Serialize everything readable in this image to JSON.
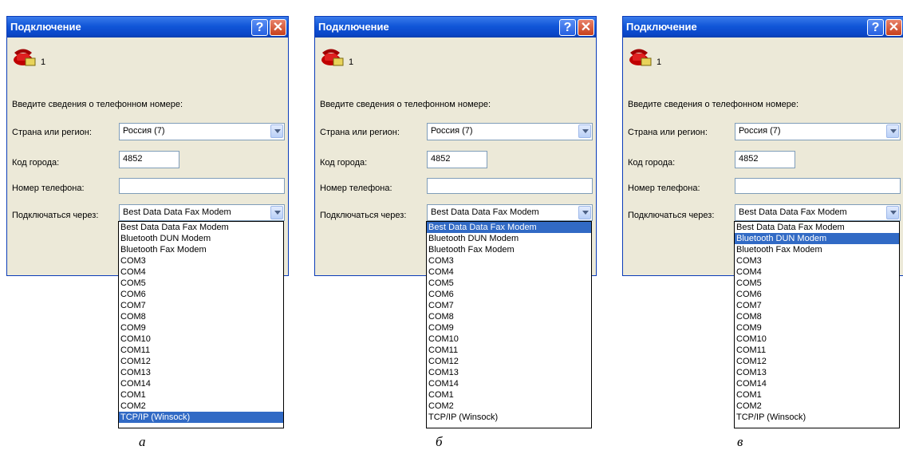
{
  "panels": [
    {
      "title": "Подключение",
      "entry_name": "1",
      "prompt": "Введите сведения о телефонном номере:",
      "labels": {
        "country": "Страна или регион:",
        "city": "Код города:",
        "phone": "Номер телефона:",
        "via": "Подключаться через:"
      },
      "country_value": "Россия (7)",
      "city_value": "4852",
      "phone_value": "",
      "via_value": "Best Data Data Fax Modem",
      "options": [
        "Best Data Data Fax Modem",
        "Bluetooth DUN Modem",
        "Bluetooth Fax Modem",
        "COM3",
        "COM4",
        "COM5",
        "COM6",
        "COM7",
        "COM8",
        "COM9",
        "COM10",
        "COM11",
        "COM12",
        "COM13",
        "COM14",
        "COM1",
        "COM2",
        "TCP/IP (Winsock)"
      ],
      "highlighted_option": "TCP/IP (Winsock)",
      "caption": "а"
    },
    {
      "title": "Подключение",
      "entry_name": "1",
      "prompt": "Введите сведения о телефонном номере:",
      "labels": {
        "country": "Страна или регион:",
        "city": "Код города:",
        "phone": "Номер телефона:",
        "via": "Подключаться через:"
      },
      "country_value": "Россия (7)",
      "city_value": "4852",
      "phone_value": "",
      "via_value": "Best Data Data Fax Modem",
      "options": [
        "Best Data Data Fax Modem",
        "Bluetooth DUN Modem",
        "Bluetooth Fax Modem",
        "COM3",
        "COM4",
        "COM5",
        "COM6",
        "COM7",
        "COM8",
        "COM9",
        "COM10",
        "COM11",
        "COM12",
        "COM13",
        "COM14",
        "COM1",
        "COM2",
        "TCP/IP (Winsock)"
      ],
      "highlighted_option": "Best Data Data Fax Modem",
      "caption": "б"
    },
    {
      "title": "Подключение",
      "entry_name": "1",
      "prompt": "Введите сведения о телефонном номере:",
      "labels": {
        "country": "Страна или регион:",
        "city": "Код города:",
        "phone": "Номер телефона:",
        "via": "Подключаться через:"
      },
      "country_value": "Россия (7)",
      "city_value": "4852",
      "phone_value": "",
      "via_value": "Best Data Data Fax Modem",
      "options": [
        "Best Data Data Fax Modem",
        "Bluetooth DUN Modem",
        "Bluetooth Fax Modem",
        "COM3",
        "COM4",
        "COM5",
        "COM6",
        "COM7",
        "COM8",
        "COM9",
        "COM10",
        "COM11",
        "COM12",
        "COM13",
        "COM14",
        "COM1",
        "COM2",
        "TCP/IP (Winsock)"
      ],
      "highlighted_option": "Bluetooth DUN Modem",
      "caption": "в"
    }
  ],
  "icons": {
    "help": "help-icon",
    "close": "close-icon",
    "phone": "phone-icon",
    "dropdown": "chevron-down-icon"
  },
  "colors": {
    "titlebar": "#0a46c8",
    "selection": "#316ac5",
    "dialog_bg": "#ece9d8"
  }
}
